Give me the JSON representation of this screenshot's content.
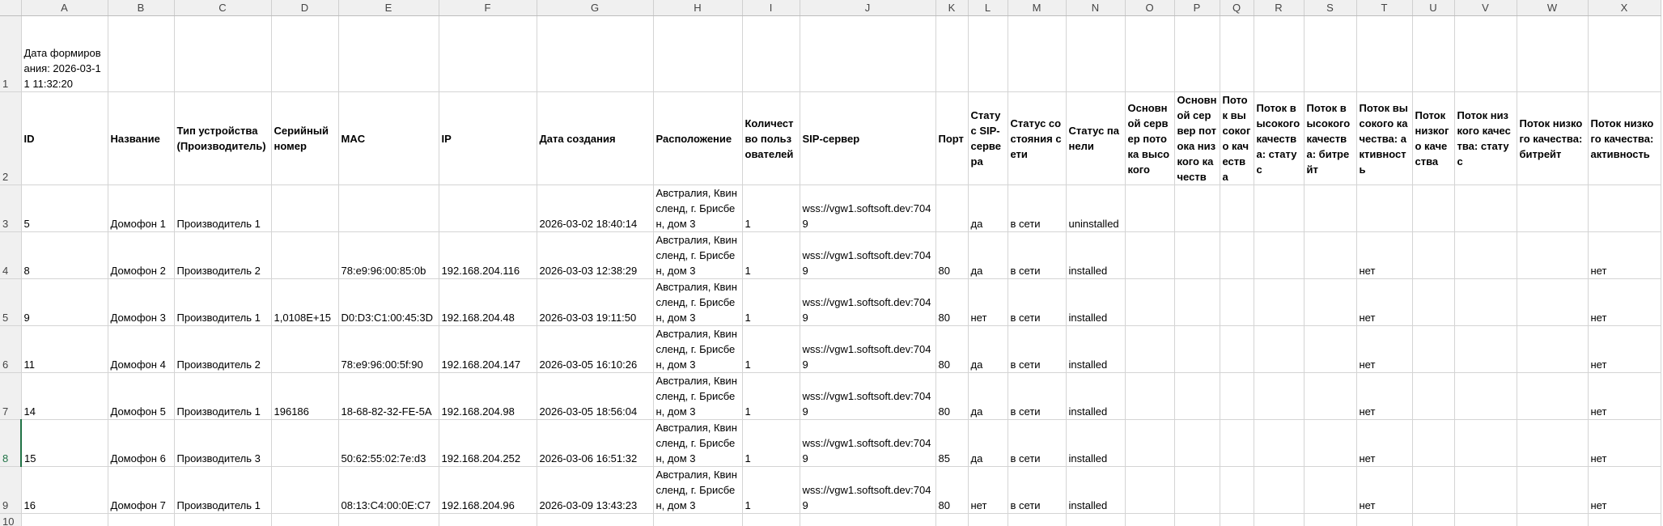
{
  "columns": [
    "A",
    "B",
    "C",
    "D",
    "E",
    "F",
    "G",
    "H",
    "I",
    "J",
    "K",
    "L",
    "M",
    "N",
    "O",
    "P",
    "Q",
    "R",
    "S",
    "T",
    "U",
    "V",
    "W",
    "X"
  ],
  "row_numbers": [
    "1",
    "2",
    "3",
    "4",
    "5",
    "6",
    "7",
    "8",
    "9",
    "10"
  ],
  "formation_date": "Дата формирования: 2026-03-11 11:32:20",
  "headers": [
    "ID",
    "Название",
    "Тип устройства (Производитель)",
    "Серийный номер",
    "MAC",
    "IP",
    "Дата создания",
    "Расположение",
    "Количество пользователей",
    "SIP-сервер",
    "Порт",
    "Статус SIP-сервера",
    "Статус состояния сети",
    "Статус панели",
    "Основной сервер потока высокого",
    "Основной сервер потока низкого качеств",
    "Поток высокого качества",
    "Поток высокого качества: статус",
    "Поток высокого качества: битрейт",
    "Поток высокого качества: активность",
    "Поток низкого качества",
    "Поток низкого качества: статус",
    "Поток низкого качества: битрейт",
    "Поток низкого качества: активность"
  ],
  "rows": [
    [
      "5",
      "Домофон 1",
      "Производитель 1",
      "",
      "",
      "",
      "2026-03-02 18:40:14",
      "Австралия, Квинсленд, г. Брисбен, дом 3",
      "1",
      "wss://vgw1.softsoft.dev:7049",
      "",
      "да",
      "в сети",
      "uninstalled",
      "",
      "",
      "",
      "",
      "",
      "",
      "",
      "",
      "",
      ""
    ],
    [
      "8",
      "Домофон 2",
      "Производитель 2",
      "",
      "78:e9:96:00:85:0b",
      "192.168.204.116",
      "2026-03-03 12:38:29",
      "Австралия, Квинсленд, г. Брисбен, дом 3",
      "1",
      "wss://vgw1.softsoft.dev:7049",
      "80",
      "да",
      "в сети",
      "installed",
      "",
      "",
      "",
      "",
      "",
      "нет",
      "",
      "",
      "",
      "нет"
    ],
    [
      "9",
      "Домофон 3",
      "Производитель 1",
      "1,0108E+15",
      "D0:D3:C1:00:45:3D",
      "192.168.204.48",
      "2026-03-03 19:11:50",
      "Австралия, Квинсленд, г. Брисбен, дом 3",
      "1",
      "wss://vgw1.softsoft.dev:7049",
      "80",
      "нет",
      "в сети",
      "installed",
      "",
      "",
      "",
      "",
      "",
      "нет",
      "",
      "",
      "",
      "нет"
    ],
    [
      "11",
      "Домофон 4",
      "Производитель 2",
      "",
      "78:e9:96:00:5f:90",
      "192.168.204.147",
      "2026-03-05 16:10:26",
      "Австралия, Квинсленд, г. Брисбен, дом 3",
      "1",
      "wss://vgw1.softsoft.dev:7049",
      "80",
      "да",
      "в сети",
      "installed",
      "",
      "",
      "",
      "",
      "",
      "нет",
      "",
      "",
      "",
      "нет"
    ],
    [
      "14",
      "Домофон 5",
      "Производитель 1",
      "196186",
      "18-68-82-32-FE-5A",
      "192.168.204.98",
      "2026-03-05 18:56:04",
      "Австралия, Квинсленд, г. Брисбен, дом 3",
      "1",
      "wss://vgw1.softsoft.dev:7049",
      "80",
      "да",
      "в сети",
      "installed",
      "",
      "",
      "",
      "",
      "",
      "нет",
      "",
      "",
      "",
      "нет"
    ],
    [
      "15",
      "Домофон 6",
      "Производитель 3",
      "",
      "50:62:55:02:7e:d3",
      "192.168.204.252",
      "2026-03-06 16:51:32",
      "Австралия, Квинсленд, г. Брисбен, дом 3",
      "1",
      "wss://vgw1.softsoft.dev:7049",
      "85",
      "да",
      "в сети",
      "installed",
      "",
      "",
      "",
      "",
      "",
      "нет",
      "",
      "",
      "",
      "нет"
    ],
    [
      "16",
      "Домофон 7",
      "Производитель 1",
      "",
      "08:13:C4:00:0E:C7",
      "192.168.204.96",
      "2026-03-09 13:43:23",
      "Австралия, Квинсленд, г. Брисбен, дом 3",
      "1",
      "wss://vgw1.softsoft.dev:7049",
      "80",
      "нет",
      "в сети",
      "installed",
      "",
      "",
      "",
      "",
      "",
      "нет",
      "",
      "",
      "",
      "нет"
    ]
  ]
}
